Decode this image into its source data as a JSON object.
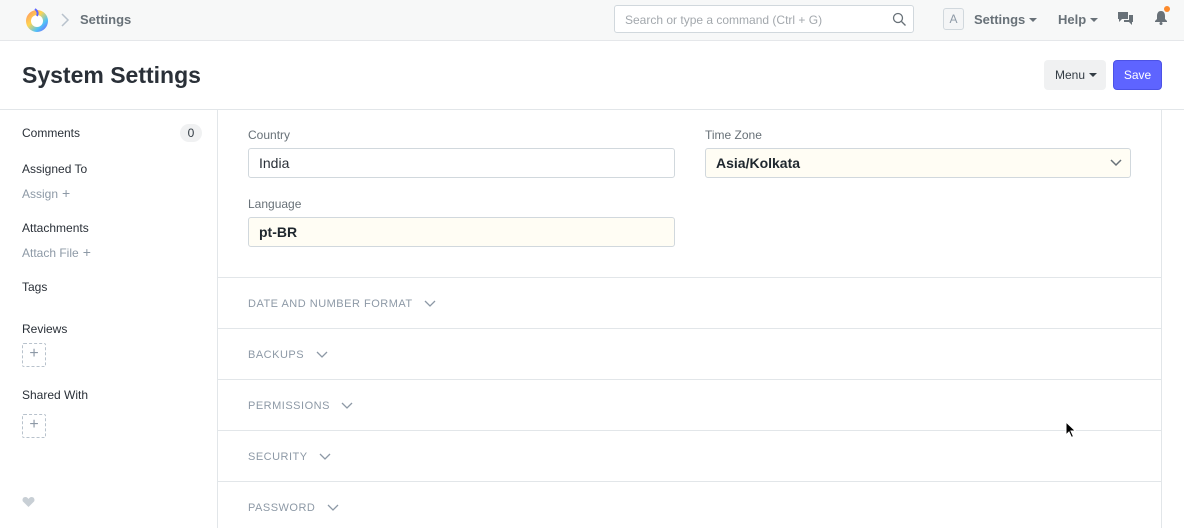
{
  "navbar": {
    "breadcrumb": "Settings",
    "search_placeholder": "Search or type a command (Ctrl + G)",
    "avatar_letter": "A",
    "settings_label": "Settings",
    "help_label": "Help",
    "notification_dot_color": "#fd8a2b"
  },
  "page": {
    "title": "System Settings",
    "menu_label": "Menu",
    "save_label": "Save",
    "accent_color": "#5e64ff"
  },
  "sidebar": {
    "comments_label": "Comments",
    "comments_count": "0",
    "assigned_to_label": "Assigned To",
    "assign_link": "Assign",
    "attachments_label": "Attachments",
    "attach_file_link": "Attach File",
    "tags_label": "Tags",
    "reviews_label": "Reviews",
    "shared_with_label": "Shared With",
    "add_symbol": "+"
  },
  "form": {
    "country_label": "Country",
    "country_value": "India",
    "timezone_label": "Time Zone",
    "timezone_value": "Asia/Kolkata",
    "language_label": "Language",
    "language_value": "pt-BR"
  },
  "sections": [
    {
      "title": "DATE AND NUMBER FORMAT"
    },
    {
      "title": "BACKUPS"
    },
    {
      "title": "PERMISSIONS"
    },
    {
      "title": "SECURITY"
    },
    {
      "title": "PASSWORD"
    }
  ]
}
